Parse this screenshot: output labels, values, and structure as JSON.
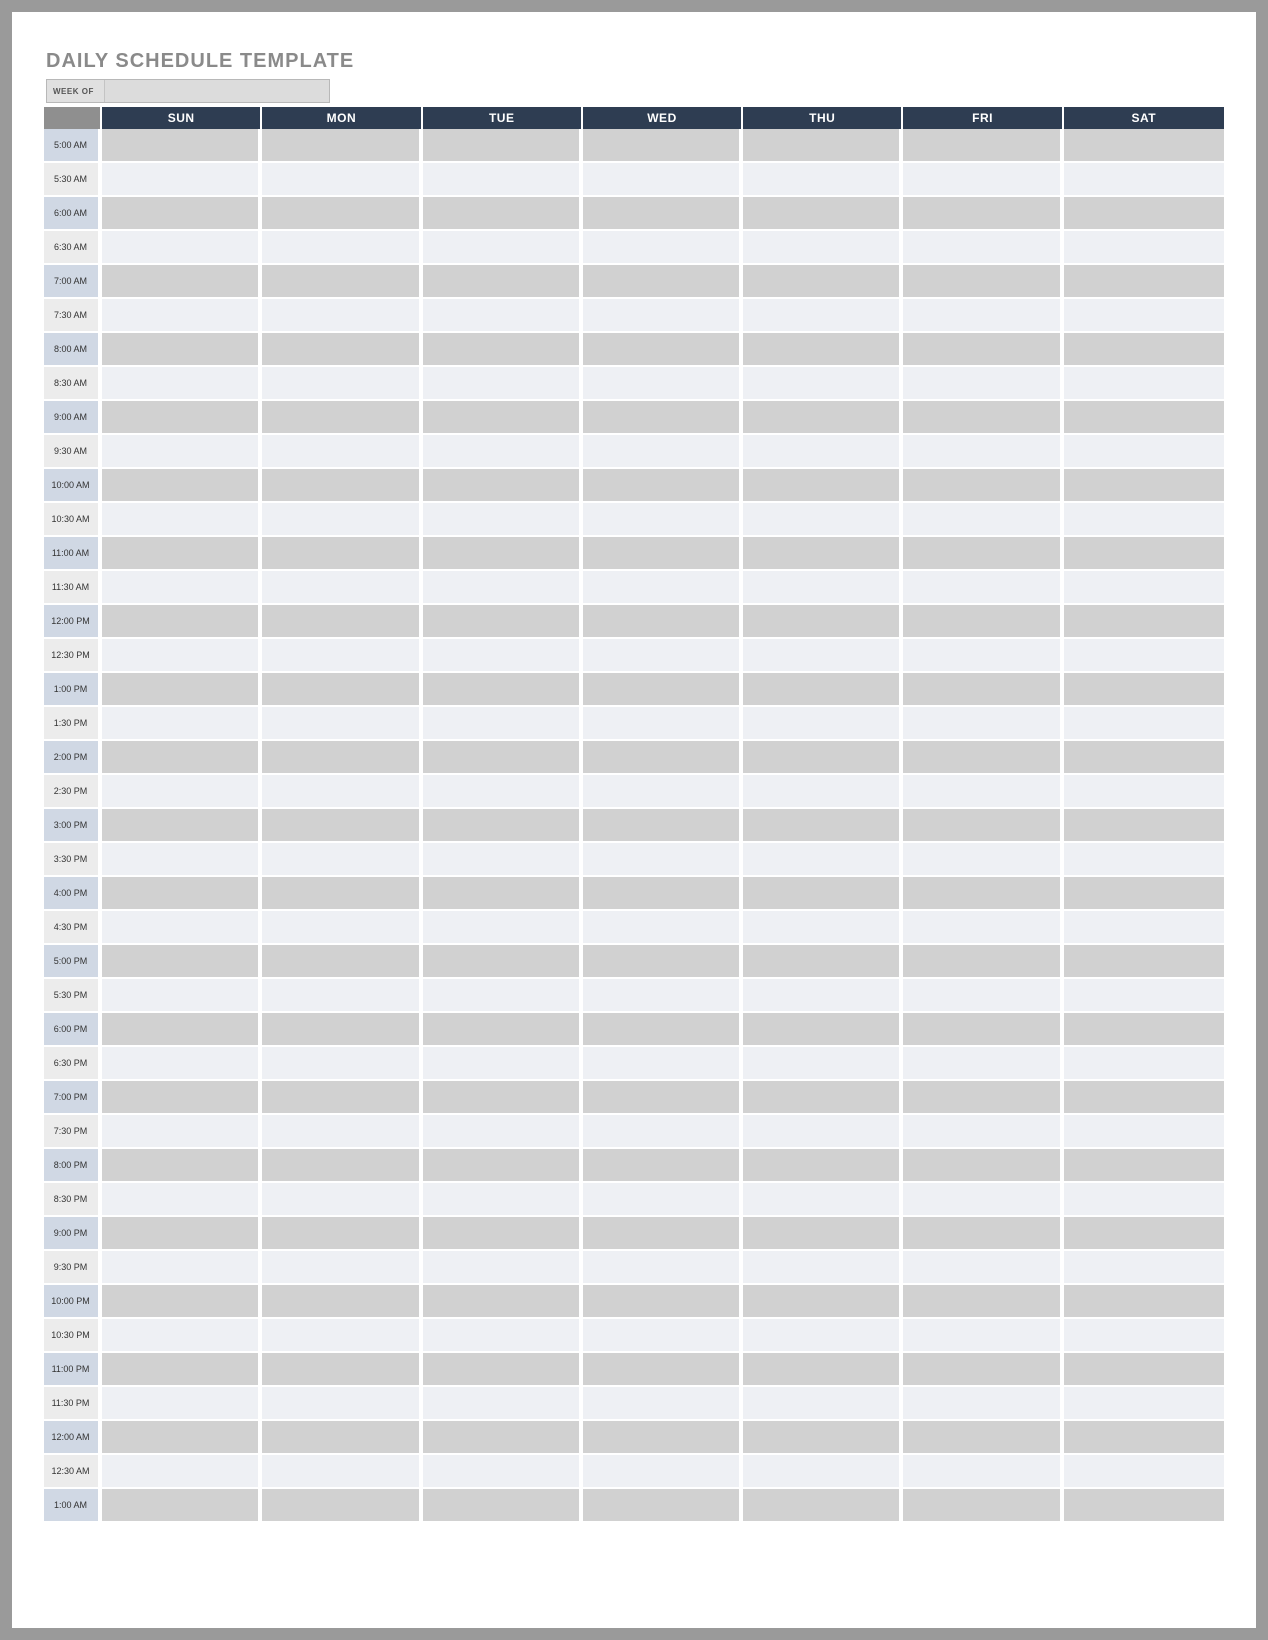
{
  "title": "DAILY SCHEDULE TEMPLATE",
  "week_of_label": "WEEK OF",
  "week_of_value": "",
  "days": [
    "SUN",
    "MON",
    "TUE",
    "WED",
    "THU",
    "FRI",
    "SAT"
  ],
  "times": [
    "5:00 AM",
    "5:30 AM",
    "6:00 AM",
    "6:30 AM",
    "7:00 AM",
    "7:30 AM",
    "8:00 AM",
    "8:30 AM",
    "9:00 AM",
    "9:30 AM",
    "10:00 AM",
    "10:30 AM",
    "11:00 AM",
    "11:30 AM",
    "12:00 PM",
    "12:30 PM",
    "1:00 PM",
    "1:30 PM",
    "2:00 PM",
    "2:30 PM",
    "3:00 PM",
    "3:30 PM",
    "4:00 PM",
    "4:30 PM",
    "5:00 PM",
    "5:30 PM",
    "6:00 PM",
    "6:30 PM",
    "7:00 PM",
    "7:30 PM",
    "8:00 PM",
    "8:30 PM",
    "9:00 PM",
    "9:30 PM",
    "10:00 PM",
    "10:30 PM",
    "11:00 PM",
    "11:30 PM",
    "12:00 AM",
    "12:30 AM",
    "1:00 AM"
  ]
}
